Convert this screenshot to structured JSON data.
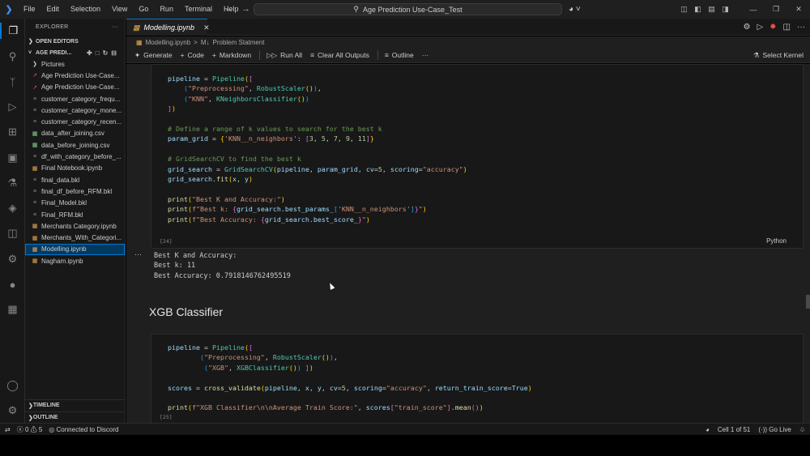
{
  "menu": [
    "File",
    "Edit",
    "Selection",
    "View",
    "Go",
    "Run",
    "Terminal",
    "Help"
  ],
  "search": {
    "text": "Age Prediction Use-Case_Test"
  },
  "sidebar": {
    "explorer_title": "EXPLORER",
    "open_editors": "OPEN EDITORS",
    "folder_name": "AGE PREDI...",
    "files": [
      {
        "name": "Pictures",
        "kind": "folder"
      },
      {
        "name": "Age Prediction Use-Case...",
        "kind": "pdf"
      },
      {
        "name": "Age Prediction Use-Case...",
        "kind": "pdf"
      },
      {
        "name": "customer_category_frequ...",
        "kind": "bkl"
      },
      {
        "name": "customer_category_mone...",
        "kind": "bkl"
      },
      {
        "name": "customer_category_recen...",
        "kind": "bkl"
      },
      {
        "name": "data_after_joining.csv",
        "kind": "csv"
      },
      {
        "name": "data_before_joining.csv",
        "kind": "csv"
      },
      {
        "name": "df_with_category_before_...",
        "kind": "bkl"
      },
      {
        "name": "Final Notebook.ipynb",
        "kind": "nb"
      },
      {
        "name": "final_data.bkl",
        "kind": "bkl"
      },
      {
        "name": "final_df_before_RFM.bkl",
        "kind": "bkl"
      },
      {
        "name": "Final_Model.bkl",
        "kind": "bkl"
      },
      {
        "name": "Final_RFM.bkl",
        "kind": "bkl"
      },
      {
        "name": "Merchants Category.ipynb",
        "kind": "nb"
      },
      {
        "name": "Merchants_With_Categori...",
        "kind": "nb"
      },
      {
        "name": "Modelling.ipynb",
        "kind": "nb",
        "selected": true
      },
      {
        "name": "Nagham.ipynb",
        "kind": "nb"
      }
    ],
    "timeline": "TIMELINE",
    "outline": "OUTLINE"
  },
  "tab": {
    "label": "Modelling.ipynb"
  },
  "breadcrumb": {
    "file": "Modelling.ipynb",
    "sep": ">",
    "section": "Problem Statment"
  },
  "toolbar": {
    "generate": "Generate",
    "code": "Code",
    "markdown": "Markdown",
    "run_all": "Run All",
    "clear_outputs": "Clear All Outputs",
    "outline": "Outline",
    "more": "···",
    "select_kernel": "Select Kernel"
  },
  "cells": {
    "cell24_count": "[24]",
    "cell24_lang": "Python",
    "cell24_output": [
      "Best K and Accuracy:",
      "Best k: 11",
      "Best Accuracy: 0.7918146762495519"
    ],
    "heading": "XGB Classifier",
    "cell25_count": "[25]"
  },
  "status": {
    "errors": "0",
    "warnings": "5",
    "discord": "Connected to Discord",
    "cell": "Cell 1 of 51",
    "golive": "Go Live"
  }
}
